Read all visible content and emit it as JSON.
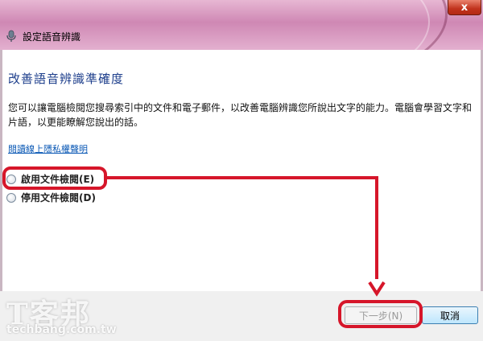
{
  "window": {
    "title": "設定語音辨識",
    "close_label": "x",
    "mic_icon": "microphone-icon"
  },
  "page": {
    "heading": "改善語音辨識準確度",
    "description": "您可以讓電腦檢閱您搜尋索引中的文件和電子郵件，以改善電腦辨識您所說出文字的能力。電腦會學習文字和片語，以更能瞭解您說出的話。",
    "privacy_link": "閱讀線上隱私權聲明"
  },
  "options": [
    {
      "label": "啟用文件檢閱(E)"
    },
    {
      "label": "停用文件檢閱(D)"
    }
  ],
  "buttons": {
    "next": "下一步(N)",
    "cancel": "取消"
  },
  "watermark": {
    "name": "T客邦",
    "site": "techbang.com.tw"
  },
  "colors": {
    "highlight": "#d6162a",
    "heading": "#1e3f8c",
    "link": "#0a58b5"
  }
}
